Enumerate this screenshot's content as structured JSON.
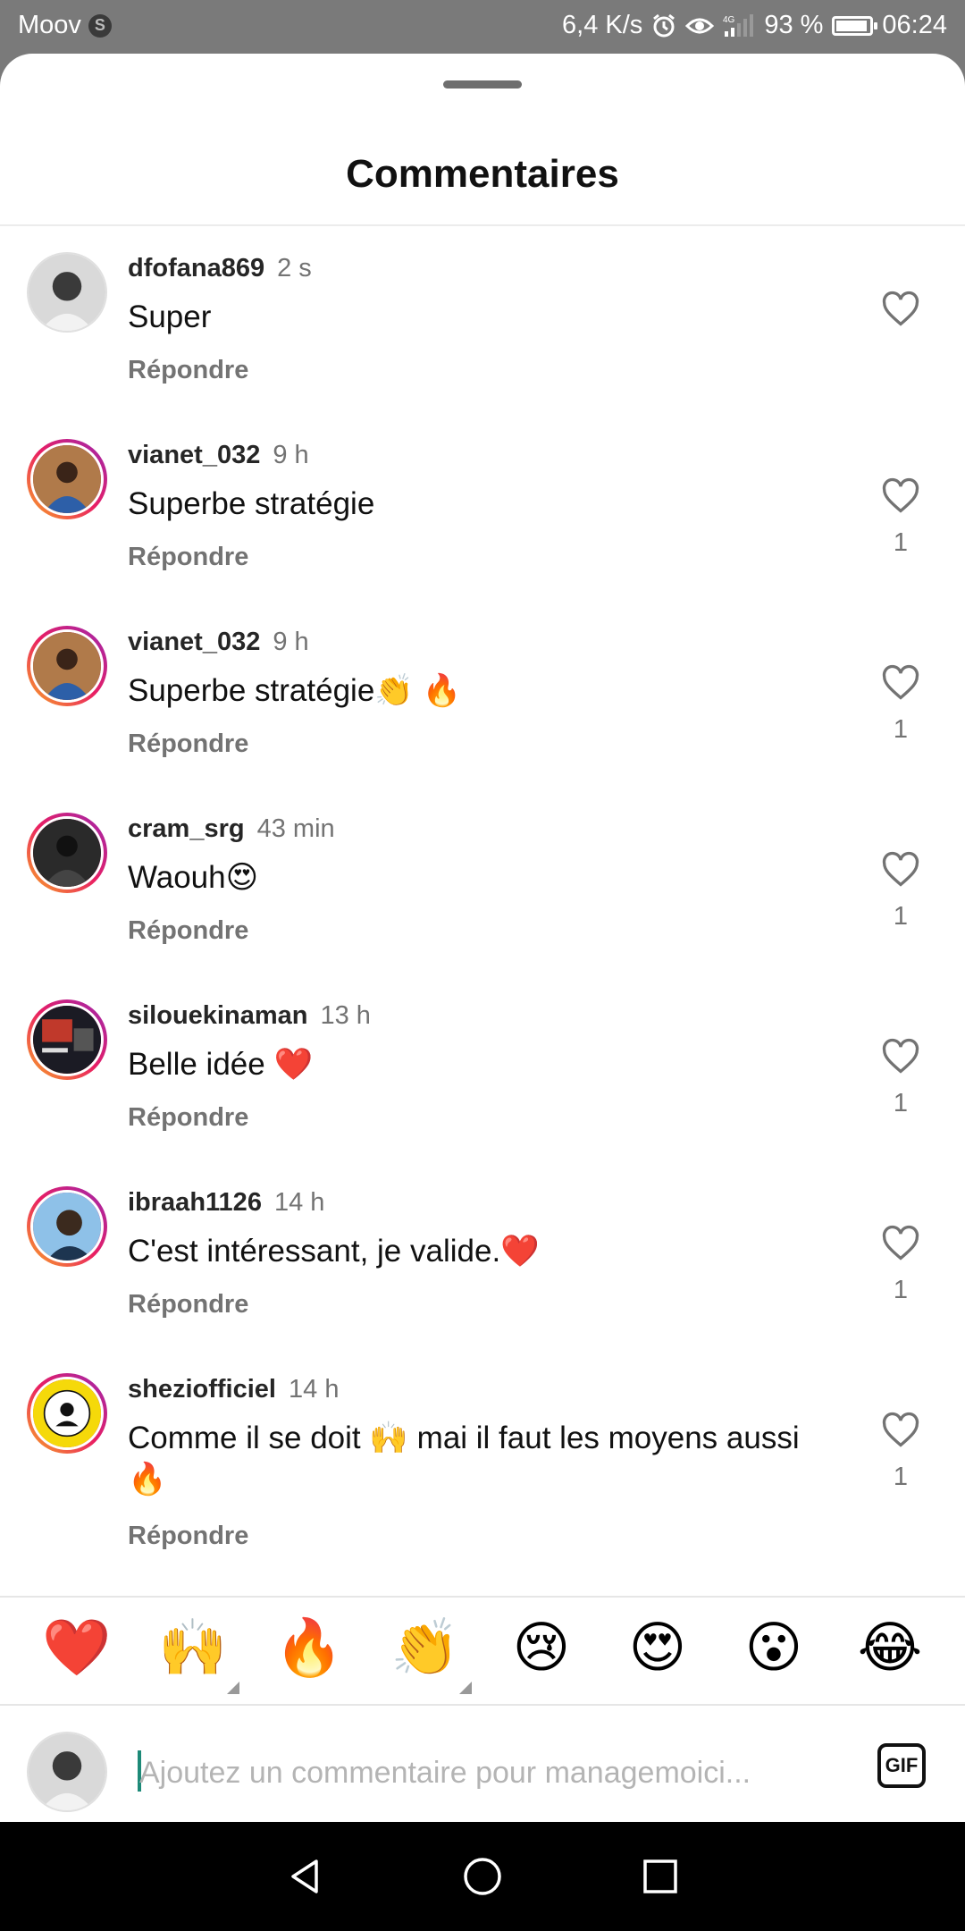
{
  "status_bar": {
    "carrier": "Moov",
    "carrier_badge": "S",
    "speed": "6,4 K/s",
    "network": "4G",
    "battery": "93 %",
    "battery_level": 0.93,
    "time": "06:24",
    "icons": [
      "alarm-icon",
      "eye-icon",
      "signal-icon",
      "battery-icon"
    ]
  },
  "sheet": {
    "title": "Commentaires"
  },
  "comments": [
    {
      "username": "dfofana869",
      "time": "2 s",
      "text": "Super",
      "reply": "Répondre",
      "likes": "",
      "avatar": "profile-photo-man-grey"
    },
    {
      "username": "vianet_032",
      "time": "9 h",
      "text": "Superbe stratégie",
      "reply": "Répondre",
      "likes": "1",
      "avatar": "profile-photo-man-blue-jersey"
    },
    {
      "username": "vianet_032",
      "time": "9 h",
      "text": "Superbe stratégie👏 🔥",
      "reply": "Répondre",
      "likes": "1",
      "avatar": "profile-photo-man-blue-jersey"
    },
    {
      "username": "cram_srg",
      "time": "43 min",
      "text": "Waouh😍",
      "reply": "Répondre",
      "likes": "1",
      "avatar": "profile-photo-dark"
    },
    {
      "username": "silouekinaman",
      "time": "13 h",
      "text": "Belle idée ❤️",
      "reply": "Répondre",
      "likes": "1",
      "avatar": "profile-photo-poster"
    },
    {
      "username": "ibraah1126",
      "time": "14 h",
      "text": "C'est intéressant, je valide.❤️",
      "reply": "Répondre",
      "likes": "1",
      "avatar": "profile-photo-selfie"
    },
    {
      "username": "sheziofficiel",
      "time": "14 h",
      "text": "Comme il se doit 🙌 mai il faut les moyens aussi 🔥",
      "reply": "Répondre",
      "likes": "1",
      "avatar": "profile-logo-shezi"
    }
  ],
  "quick_reactions": [
    "❤️",
    "🙌",
    "🔥",
    "👏",
    "😢",
    "😍",
    "😮",
    "😂"
  ],
  "composer": {
    "placeholder": "Ajoutez un commentaire pour managemoici...",
    "gif_label": "GIF"
  },
  "colors": {
    "accent_caret": "#1d8a78",
    "story_ring": "#e91e63",
    "muted_text": "#737373"
  }
}
